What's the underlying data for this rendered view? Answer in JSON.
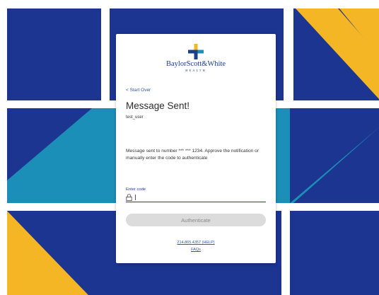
{
  "logo": {
    "name": "BaylorScott&White",
    "sub": "HEALTH"
  },
  "nav": {
    "back_label": "< Start Over"
  },
  "heading": {
    "title": "Message Sent!",
    "username": "test_user"
  },
  "message": "Message sent to number *** *** 1234. Approve the notification or manually enter the code to authenticate",
  "code": {
    "label": "Enter code",
    "value": "",
    "placeholder": ""
  },
  "actions": {
    "authenticate_label": "Authenticate"
  },
  "footer": {
    "phone": "214.865.4357 (HELP)",
    "faq": "FAQs"
  },
  "colors": {
    "navy": "#1b3590",
    "teal": "#1c8fb8",
    "gold": "#f5b625",
    "link": "#2f5aa8",
    "button_disabled": "#dcdcdc"
  }
}
